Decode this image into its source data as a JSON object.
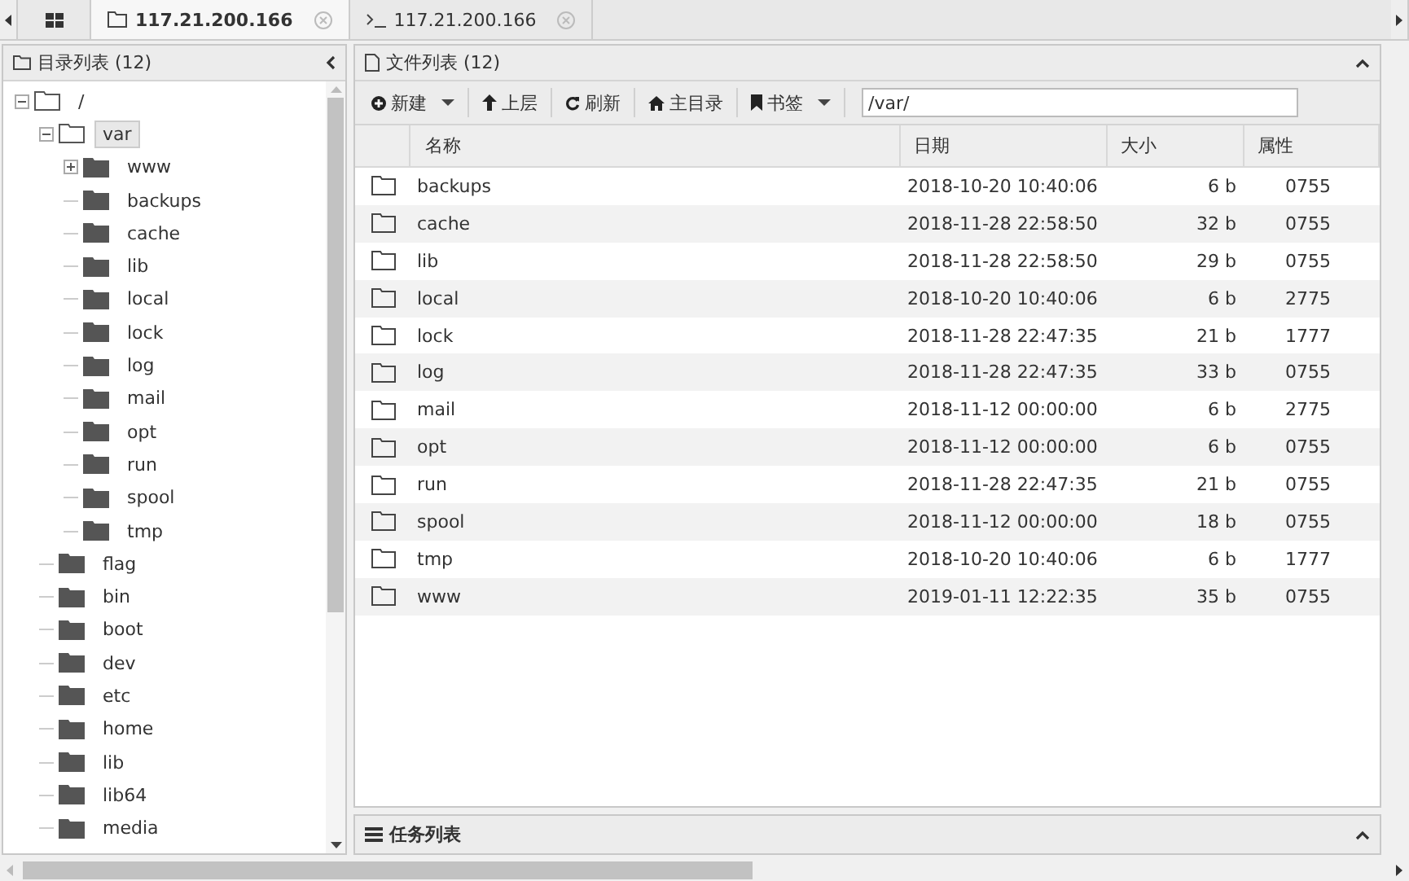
{
  "tabs": [
    {
      "kind": "home",
      "selected": false
    },
    {
      "kind": "files",
      "label": "117.21.200.166",
      "selected": true
    },
    {
      "kind": "terminal",
      "label": "117.21.200.166",
      "selected": false
    }
  ],
  "directory_panel": {
    "title": "目录列表 (12)",
    "tree": [
      {
        "name": "/",
        "expanded": true,
        "selected": false,
        "children": [
          {
            "name": "var",
            "expanded": true,
            "selected": true,
            "children": [
              {
                "name": "www",
                "expanded": false,
                "selected": false
              },
              {
                "name": "backups",
                "selected": false
              },
              {
                "name": "cache",
                "selected": false
              },
              {
                "name": "lib",
                "selected": false
              },
              {
                "name": "local",
                "selected": false
              },
              {
                "name": "lock",
                "selected": false
              },
              {
                "name": "log",
                "selected": false
              },
              {
                "name": "mail",
                "selected": false
              },
              {
                "name": "opt",
                "selected": false
              },
              {
                "name": "run",
                "selected": false
              },
              {
                "name": "spool",
                "selected": false
              },
              {
                "name": "tmp",
                "selected": false
              }
            ]
          },
          {
            "name": "flag",
            "selected": false
          },
          {
            "name": "bin",
            "selected": false
          },
          {
            "name": "boot",
            "selected": false
          },
          {
            "name": "dev",
            "selected": false
          },
          {
            "name": "etc",
            "selected": false
          },
          {
            "name": "home",
            "selected": false
          },
          {
            "name": "lib",
            "selected": false
          },
          {
            "name": "lib64",
            "selected": false
          },
          {
            "name": "media",
            "selected": false
          }
        ]
      }
    ]
  },
  "file_panel": {
    "title": "文件列表 (12)",
    "toolbar": [
      {
        "kind": "new",
        "label": "新建",
        "dropdown": true
      },
      {
        "kind": "up",
        "label": "上层",
        "dropdown": false
      },
      {
        "kind": "refresh",
        "label": "刷新",
        "dropdown": false
      },
      {
        "kind": "home",
        "label": "主目录",
        "dropdown": false
      },
      {
        "kind": "bookmark",
        "label": "书签",
        "dropdown": true
      }
    ],
    "path": "/var/",
    "columns": [
      "名称",
      "日期",
      "大小",
      "属性"
    ],
    "rows": [
      {
        "name": "backups",
        "date": "2018-10-20 10:40:06",
        "size": "6 b",
        "mode": "0755"
      },
      {
        "name": "cache",
        "date": "2018-11-28 22:58:50",
        "size": "32 b",
        "mode": "0755"
      },
      {
        "name": "lib",
        "date": "2018-11-28 22:58:50",
        "size": "29 b",
        "mode": "0755"
      },
      {
        "name": "local",
        "date": "2018-10-20 10:40:06",
        "size": "6 b",
        "mode": "2775"
      },
      {
        "name": "lock",
        "date": "2018-11-28 22:47:35",
        "size": "21 b",
        "mode": "1777"
      },
      {
        "name": "log",
        "date": "2018-11-28 22:47:35",
        "size": "33 b",
        "mode": "0755"
      },
      {
        "name": "mail",
        "date": "2018-11-12 00:00:00",
        "size": "6 b",
        "mode": "2775"
      },
      {
        "name": "opt",
        "date": "2018-11-12 00:00:00",
        "size": "6 b",
        "mode": "0755"
      },
      {
        "name": "run",
        "date": "2018-11-28 22:47:35",
        "size": "21 b",
        "mode": "0755"
      },
      {
        "name": "spool",
        "date": "2018-11-12 00:00:00",
        "size": "18 b",
        "mode": "0755"
      },
      {
        "name": "tmp",
        "date": "2018-10-20 10:40:06",
        "size": "6 b",
        "mode": "1777"
      },
      {
        "name": "www",
        "date": "2019-01-11 12:22:35",
        "size": "35 b",
        "mode": "0755"
      }
    ]
  },
  "task_panel": {
    "title": "任务列表"
  }
}
